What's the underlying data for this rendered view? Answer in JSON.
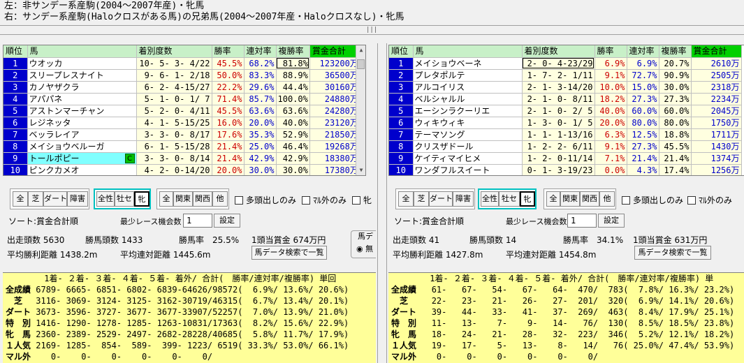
{
  "header": {
    "line1": "左：非サンデー系産駒(2004～2007年産)・牝馬",
    "line2": "右：サンデー系産駒(Haloクロスがある馬)の兄弟馬(2004～2007年産・Haloクロスなし)・牝馬"
  },
  "columns": {
    "rank": "順位",
    "name": "馬",
    "record": "着別度数",
    "win": "勝率",
    "quinella": "連対率",
    "show": "複勝率",
    "prize": "賞金合計"
  },
  "left": {
    "rows": [
      {
        "rank": "1",
        "name": "ウオッカ",
        "record": "10- 5- 3- 4/22",
        "win": "45.5%",
        "q": "68.2%",
        "s": "81.8%",
        "prize": "123200万"
      },
      {
        "rank": "2",
        "name": "スリープレスナイト",
        "record": "9- 6- 1- 2/18",
        "win": "50.0%",
        "q": "83.3%",
        "s": "88.9%",
        "prize": "36500万"
      },
      {
        "rank": "3",
        "name": "カノヤザクラ",
        "record": "6- 2- 4-15/27",
        "win": "22.2%",
        "q": "29.6%",
        "s": "44.4%",
        "prize": "30160万"
      },
      {
        "rank": "4",
        "name": "アパパネ",
        "record": "5- 1- 0- 1/ 7",
        "win": "71.4%",
        "q": "85.7%",
        "s": "100.0%",
        "prize": "24880万"
      },
      {
        "rank": "5",
        "name": "アストンマーチャン",
        "record": "5- 2- 0- 4/11",
        "win": "45.5%",
        "q": "63.6%",
        "s": "63.6%",
        "prize": "24280万"
      },
      {
        "rank": "6",
        "name": "レジネッタ",
        "record": "4- 1- 5-15/25",
        "win": "16.0%",
        "q": "20.0%",
        "s": "40.0%",
        "prize": "23120万"
      },
      {
        "rank": "7",
        "name": "ベッラレイア",
        "record": "3- 3- 0- 8/17",
        "win": "17.6%",
        "q": "35.3%",
        "s": "52.9%",
        "prize": "21850万"
      },
      {
        "rank": "8",
        "name": "メイショウベルーガ",
        "record": "6- 1- 5-15/28",
        "win": "21.4%",
        "q": "25.0%",
        "s": "46.4%",
        "prize": "19268万"
      },
      {
        "rank": "9",
        "name": "トールポピー",
        "record": "3- 3- 0- 8/14",
        "win": "21.4%",
        "q": "42.9%",
        "s": "42.9%",
        "prize": "18380万",
        "badge": "C"
      },
      {
        "rank": "10",
        "name": "ピンクカメオ",
        "record": "4- 2- 0-14/20",
        "win": "20.0%",
        "q": "30.0%",
        "s": "30.0%",
        "prize": "17380万"
      }
    ],
    "sort": "ソート:賞金合計順",
    "minrace_label": "最少レース機会数",
    "minrace_value": "1",
    "set_btn": "設定",
    "starters": "出走頭数 5630",
    "winners": "勝馬頭数 1433",
    "winrate": "勝馬率　25.5%",
    "avgprize": "1頭当賞金 674万円",
    "avgwin": "平均勝利距離 1438.2m",
    "avgq": "平均連対距離 1445.6m",
    "search_btn": "馬データ検索で一覧",
    "side_label": "馬デ",
    "stats_header": "　 　　　1着- ２着- ３着- ４着- ５着- 着外/ 合計(　勝率/連対率/複勝率) 単回",
    "stats": [
      {
        "label": "全成績",
        "data": "6789- 6665- 6851- 6802- 6839-64626/98572(  6.9%/ 13.6%/ 20.6%)"
      },
      {
        "label": "　芝　",
        "data": "3116- 3069- 3124- 3125- 3162-30719/46315(  6.7%/ 13.4%/ 20.1%)"
      },
      {
        "label": "ダート",
        "data": "3673- 3596- 3727- 3677- 3677-33907/52257(  7.0%/ 13.9%/ 21.0%)"
      },
      {
        "label": "特　別",
        "data": "1416- 1290- 1278- 1285- 1263-10831/17363(  8.2%/ 15.6%/ 22.9%)"
      },
      {
        "label": "牝　馬",
        "data": "2360- 2389- 2529- 2497- 2682-28228/40685(  5.8%/ 11.7%/ 17.9%)"
      },
      {
        "label": "１人気",
        "data": "2169- 1285-  854-  589-  399- 1223/ 6519( 33.3%/ 53.0%/ 66.1%)"
      },
      {
        "label": "マル外",
        "data": "   0-    0-    0-    0-    0-    0/"
      }
    ]
  },
  "right": {
    "rows": [
      {
        "rank": "1",
        "name": "メイショウベーネ",
        "record": "2- 0- 4-23/29",
        "win": "6.9%",
        "q": "6.9%",
        "s": "20.7%",
        "prize": "2610万"
      },
      {
        "rank": "2",
        "name": "プレタポルテ",
        "record": "1- 7- 2- 1/11",
        "win": "9.1%",
        "q": "72.7%",
        "s": "90.9%",
        "prize": "2505万"
      },
      {
        "rank": "3",
        "name": "アルコイリス",
        "record": "2- 1- 3-14/20",
        "win": "10.0%",
        "q": "15.0%",
        "s": "30.0%",
        "prize": "2318万"
      },
      {
        "rank": "4",
        "name": "ベルシャルル",
        "record": "2- 1- 0- 8/11",
        "win": "18.2%",
        "q": "27.3%",
        "s": "27.3%",
        "prize": "2234万"
      },
      {
        "rank": "5",
        "name": "エーシンラクーリエ",
        "record": "2- 1- 0- 2/ 5",
        "win": "40.0%",
        "q": "60.0%",
        "s": "60.0%",
        "prize": "2045万"
      },
      {
        "rank": "6",
        "name": "ウィキウィキ",
        "record": "1- 3- 0- 1/ 5",
        "win": "20.0%",
        "q": "80.0%",
        "s": "80.0%",
        "prize": "1750万"
      },
      {
        "rank": "7",
        "name": "テーマソング",
        "record": "1- 1- 1-13/16",
        "win": "6.3%",
        "q": "12.5%",
        "s": "18.8%",
        "prize": "1711万"
      },
      {
        "rank": "8",
        "name": "クリスザドール",
        "record": "1- 2- 2- 6/11",
        "win": "9.1%",
        "q": "27.3%",
        "s": "45.5%",
        "prize": "1430万"
      },
      {
        "rank": "9",
        "name": "ケイティマイヒメ",
        "record": "1- 2- 0-11/14",
        "win": "7.1%",
        "q": "21.4%",
        "s": "21.4%",
        "prize": "1374万"
      },
      {
        "rank": "10",
        "name": "ワンダフルスイート",
        "record": "0- 1- 3-19/23",
        "win": "0.0%",
        "q": "4.3%",
        "s": "17.4%",
        "prize": "1256万"
      }
    ],
    "sort": "ソート:賞金合計順",
    "minrace_label": "最少レース機会数",
    "minrace_value": "1",
    "set_btn": "設定",
    "starters": "出走頭数 41",
    "winners": "勝馬頭数 14",
    "winrate": "勝馬率　34.1%",
    "avgprize": "1頭当賞金 631万円",
    "avgwin": "平均勝利距離 1427.8m",
    "avgq": "平均連対距離 1454.8m",
    "search_btn": "馬データ検索で一覧",
    "stats_header": "　 　　　1着- ２着- ３着- ４着- ５着- 着外/ 合計(　勝率/連対率/複勝率) 単",
    "stats": [
      {
        "label": "全成績",
        "data": "  61-   67-   54-   67-   64-  470/  783(  7.8%/ 16.3%/ 23.2%)"
      },
      {
        "label": "　芝　",
        "data": "  22-   23-   21-   26-   27-  201/  320(  6.9%/ 14.1%/ 20.6%)"
      },
      {
        "label": "ダート",
        "data": "  39-   44-   33-   41-   37-  269/  463(  8.4%/ 17.9%/ 25.1%)"
      },
      {
        "label": "特　別",
        "data": "  11-   13-    7-    9-   14-   76/  130(  8.5%/ 18.5%/ 23.8%)"
      },
      {
        "label": "牝　馬",
        "data": "  18-   24-   21-   28-   32-  223/  346(  5.2%/ 12.1%/ 18.2%)"
      },
      {
        "label": "１人気",
        "data": "  19-   17-    5-   13-    8-   14/   76( 25.0%/ 47.4%/ 53.9%)"
      },
      {
        "label": "マル外",
        "data": "   0-    0-    0-    0-    0-    0/"
      }
    ]
  },
  "filters": {
    "all": "全",
    "turf": "芝",
    "dirt": "ダート",
    "obstacle": "障害",
    "allsex": "全性",
    "male": "牡セ",
    "female": "牝",
    "allregion": "全",
    "kanto": "関東",
    "kansai": "関西",
    "other": "他",
    "multi": "多頭出しのみ",
    "foreign": "ﾏﾙ外のみ",
    "mare": "牝"
  },
  "radio_label": "無"
}
